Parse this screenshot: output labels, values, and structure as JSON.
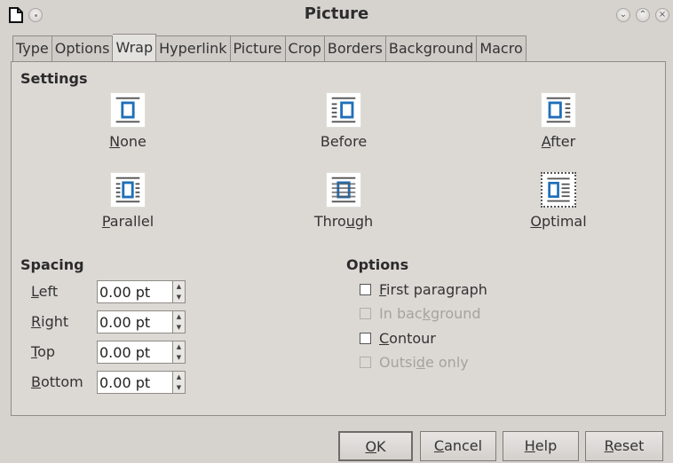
{
  "window": {
    "title": "Picture",
    "buttons": [
      "minimize",
      "maximize",
      "close"
    ]
  },
  "tabs": [
    {
      "label": "Type"
    },
    {
      "label": "Options"
    },
    {
      "label": "Wrap",
      "active": true
    },
    {
      "label": "Hyperlink"
    },
    {
      "label": "Picture"
    },
    {
      "label": "Crop"
    },
    {
      "label": "Borders"
    },
    {
      "label": "Background"
    },
    {
      "label": "Macro"
    }
  ],
  "settings": {
    "title": "Settings",
    "options": [
      {
        "label_pre": "",
        "label_ul": "N",
        "label_post": "one",
        "icon": "wrap-none-icon"
      },
      {
        "label_pre": "Before",
        "label_ul": "",
        "label_post": "",
        "icon": "wrap-before-icon"
      },
      {
        "label_pre": "",
        "label_ul": "A",
        "label_post": "fter",
        "icon": "wrap-after-icon"
      },
      {
        "label_pre": "",
        "label_ul": "P",
        "label_post": "arallel",
        "icon": "wrap-parallel-icon"
      },
      {
        "label_pre": "Thro",
        "label_ul": "u",
        "label_post": "gh",
        "icon": "wrap-through-icon"
      },
      {
        "label_pre": "",
        "label_ul": "O",
        "label_post": "ptimal",
        "icon": "wrap-optimal-icon",
        "selected": true
      }
    ]
  },
  "spacing": {
    "title": "Spacing",
    "fields": [
      {
        "label_pre": "",
        "label_ul": "L",
        "label_post": "eft",
        "value": "0.00 pt"
      },
      {
        "label_pre": "",
        "label_ul": "R",
        "label_post": "ight",
        "value": "0.00 pt"
      },
      {
        "label_pre": "",
        "label_ul": "T",
        "label_post": "op",
        "value": "0.00 pt"
      },
      {
        "label_pre": "",
        "label_ul": "B",
        "label_post": "ottom",
        "value": "0.00 pt"
      }
    ]
  },
  "options": {
    "title": "Options",
    "checks": [
      {
        "label_pre": "",
        "label_ul": "F",
        "label_post": "irst paragraph",
        "checked": false,
        "enabled": true
      },
      {
        "label_pre": "In bac",
        "label_ul": "k",
        "label_post": "ground",
        "checked": false,
        "enabled": false
      },
      {
        "label_pre": "",
        "label_ul": "C",
        "label_post": "ontour",
        "checked": false,
        "enabled": true
      },
      {
        "label_pre": "Outsi",
        "label_ul": "d",
        "label_post": "e only",
        "checked": false,
        "enabled": false
      }
    ]
  },
  "buttons": {
    "ok": {
      "pre": "",
      "ul": "O",
      "post": "K"
    },
    "cancel": {
      "pre": "",
      "ul": "C",
      "post": "ancel"
    },
    "help": {
      "pre": "",
      "ul": "H",
      "post": "elp"
    },
    "reset": {
      "pre": "",
      "ul": "R",
      "post": "eset"
    }
  },
  "colors": {
    "window_bg": "#d6d3cf",
    "panel_bg": "#dcd9d5",
    "icon_blue": "#1f6fb8",
    "disabled_text": "#a6a39f"
  }
}
